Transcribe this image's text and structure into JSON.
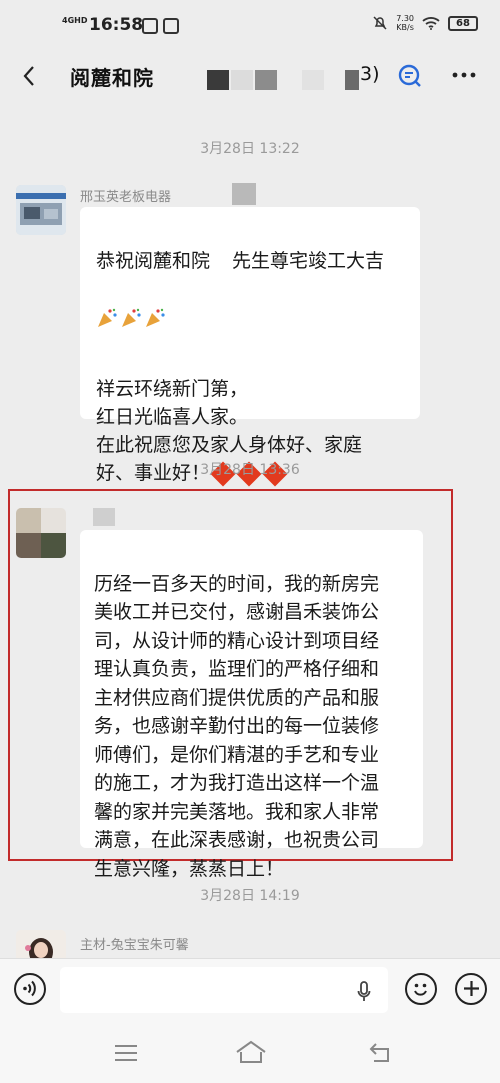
{
  "status_bar": {
    "network": "4GHD",
    "time": "16:58",
    "speed_value": "7.30",
    "speed_unit": "KB/s",
    "battery": "68"
  },
  "header": {
    "title": "阅麓和院",
    "count_suffix": "3)",
    "back_icon": "back-arrow-icon",
    "more_icon": "more-icon",
    "search_icon": "search-chat-icon"
  },
  "messages": [
    {
      "timestamp": "3月28日 13:22",
      "sender": "邢玉英老板电器",
      "line1": "恭祝阅麓和院",
      "line1b": "先生尊宅竣工大吉",
      "line2": "祥云环绕新门第，\n红日光临喜人家。\n在此祝愿您及家人身体好、家庭\n好、事业好！"
    },
    {
      "timestamp": "3月28日 13:36",
      "sender": "",
      "text": "历经一百多天的时间，我的新房完\n美收工并已交付，感谢昌禾装饰公\n司，从设计师的精心设计到项目经\n理认真负责，监理们的严格仔细和\n主材供应商们提供优质的产品和服\n务，也感谢辛勤付出的每一位装修\n师傅们，是你们精湛的手艺和专业\n的施工，才为我打造出这样一个温\n馨的家并完美落地。我和家人非常\n满意，在此深表感谢，也祝贵公司\n生意兴隆，蒸蒸日上！"
    },
    {
      "timestamp": "3月28日 14:19",
      "sender": "主材-兔宝宝朱可馨"
    }
  ],
  "input": {
    "placeholder": ""
  },
  "colors": {
    "background": "#ededed",
    "highlight": "#c22b2b",
    "bubble": "#ffffff"
  }
}
